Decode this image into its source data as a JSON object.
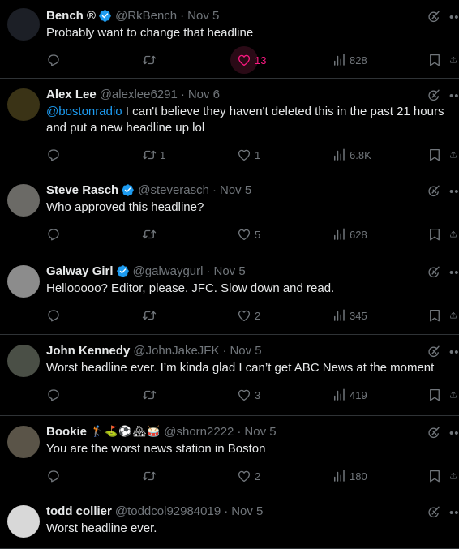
{
  "tweets": [
    {
      "name": "Bench ®",
      "verified": true,
      "handle": "@RkBench",
      "date": "Nov 5",
      "emojis": "",
      "mention": "",
      "text": "Probably want to change that headline",
      "replies": "",
      "retweets": "",
      "likes": "13",
      "liked": true,
      "views": "828",
      "avatar_color": "#1c1f26"
    },
    {
      "name": "Alex Lee",
      "verified": false,
      "handle": "@alexlee6291",
      "date": "Nov 6",
      "emojis": "",
      "mention": "@bostonradio",
      "text": " I can't believe they haven't deleted this in the past 21 hours and put a new headline up lol",
      "replies": "",
      "retweets": "1",
      "likes": "1",
      "liked": false,
      "views": "6.8K",
      "avatar_color": "#3a3316"
    },
    {
      "name": "Steve Rasch",
      "verified": true,
      "handle": "@steverasch",
      "date": "Nov 5",
      "emojis": "",
      "mention": "",
      "text": "Who approved this headline?",
      "replies": "",
      "retweets": "",
      "likes": "5",
      "liked": false,
      "views": "628",
      "avatar_color": "#6b6a66"
    },
    {
      "name": "Galway Girl",
      "verified": true,
      "handle": "@galwaygurl",
      "date": "Nov 5",
      "emojis": "",
      "mention": "",
      "text": "Hellooooo? Editor, please. JFC. Slow down and read.",
      "replies": "",
      "retweets": "",
      "likes": "2",
      "liked": false,
      "views": "345",
      "avatar_color": "#8c8c8c"
    },
    {
      "name": "John Kennedy",
      "verified": false,
      "handle": "@JohnJakeJFK",
      "date": "Nov 5",
      "emojis": "",
      "mention": "",
      "text": "Worst headline ever. I’m kinda glad I can’t get ABC News at the moment",
      "replies": "",
      "retweets": "",
      "likes": "3",
      "liked": false,
      "views": "419",
      "avatar_color": "#4a4f46"
    },
    {
      "name": "Bookie",
      "verified": false,
      "handle": "@shorn2222",
      "date": "Nov 5",
      "emojis": "🏌⛳⚽🏘🥁",
      "mention": "",
      "text": "You are the worst news station in Boston",
      "replies": "",
      "retweets": "",
      "likes": "2",
      "liked": false,
      "views": "180",
      "avatar_color": "#5a5448"
    },
    {
      "name": "todd collier",
      "verified": false,
      "handle": "@toddcol92984019",
      "date": "Nov 5",
      "emojis": "",
      "mention": "",
      "text": "Worst headline ever.",
      "replies": "",
      "retweets": "",
      "likes": "",
      "liked": false,
      "views": "",
      "avatar_color": "#d8d8d8"
    }
  ],
  "icons": {
    "reply": "reply-icon",
    "retweet": "retweet-icon",
    "like": "heart-icon",
    "views": "views-icon",
    "bookmark": "bookmark-icon",
    "share": "share-icon",
    "grok": "grok-icon",
    "more": "more-icon"
  },
  "colors": {
    "background": "#000000",
    "text": "#e7e9ea",
    "muted": "#71767b",
    "link": "#1d9bf0",
    "like": "#f91880",
    "verified": "#1d9bf0",
    "divider": "#2f3336"
  }
}
